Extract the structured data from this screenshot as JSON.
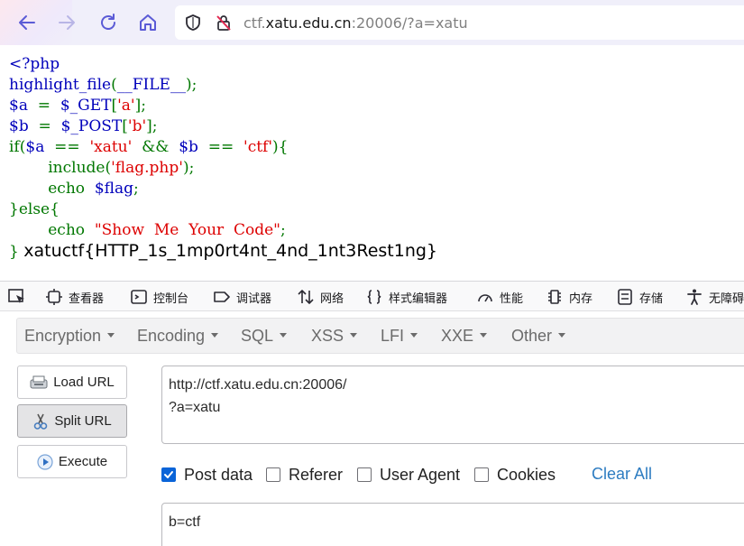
{
  "browser": {
    "url_host_prefix": "ctf.",
    "url_host": "xatu.edu.cn",
    "url_rest": ":20006/?a=xatu"
  },
  "source_code": {
    "lines": [
      "<?php",
      "highlight_file(__FILE__);",
      "$a  =  $_GET['a'];",
      "$b  =  $_POST['b'];",
      "if($a  ==  'xatu'  &&  $b  ==  'ctf'){",
      "        include('flag.php');",
      "        echo  $flag;",
      "}else{",
      "        echo  \"Show  Me  Your  Code\";",
      "}"
    ],
    "flag_output": "xatuctf{HTTP_1s_1mp0rt4nt_4nd_1nt3Rest1ng}"
  },
  "devtools": {
    "tabs": [
      "查看器",
      "控制台",
      "调试器",
      "网络",
      "样式编辑器",
      "性能",
      "内存",
      "存储",
      "无障碍"
    ]
  },
  "hackbar": {
    "menu": [
      "Encryption",
      "Encoding",
      "SQL",
      "XSS",
      "LFI",
      "XXE",
      "Other"
    ],
    "buttons": {
      "load_url": "Load URL",
      "split_url": "Split URL",
      "execute": "Execute"
    },
    "url_field": {
      "lines": [
        "http://ctf.xatu.edu.cn:20006/",
        "?a=xatu"
      ]
    },
    "options": {
      "post_data": "Post data",
      "referer": "Referer",
      "user_agent": "User Agent",
      "cookies": "Cookies",
      "clear_all": "Clear All"
    },
    "post_field": {
      "value": "b=ctf"
    }
  },
  "colors": {
    "php_default": "#0000bb",
    "php_keyword": "#007700",
    "php_string": "#dd0000",
    "checkbox_checked": "#0a64d8",
    "link": "#2d7cc1"
  }
}
